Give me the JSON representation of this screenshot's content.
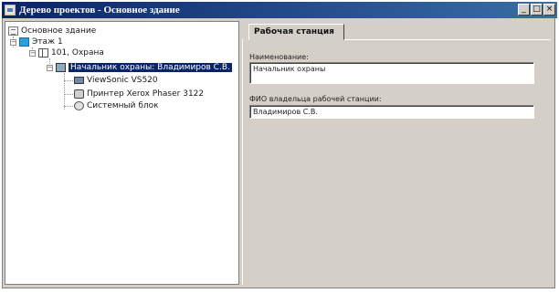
{
  "window": {
    "title": "Дерево проектов - Основное здание",
    "buttons": [
      "_",
      "□",
      "×"
    ]
  },
  "tree": {
    "nodes": [
      {
        "label": "Основное здание",
        "icon": "building-icon"
      },
      {
        "label": "Этаж 1",
        "icon": "floor-icon",
        "expander": "−"
      },
      {
        "label": "101, Охрана",
        "icon": "room-icon",
        "expander": "−"
      },
      {
        "label": "Начальник охраны: Владимиров С.В.",
        "icon": "workstation-icon",
        "expander": "−",
        "selected": true
      },
      {
        "label": "ViewSonic VS520",
        "icon": "monitor-icon"
      },
      {
        "label": "Принтер Xerox Phaser 3122",
        "icon": "printer-icon"
      },
      {
        "label": "Системный блок",
        "icon": "system-unit-icon"
      }
    ]
  },
  "details": {
    "tab_label": "Рабочая станция",
    "name_label": "Наименование:",
    "name_value": "Начальник охраны",
    "owner_label": "ФИО владельца рабочей станции:",
    "owner_value": "Владимиров С.В."
  },
  "colors": {
    "titlebar": "#0a246a",
    "selection": "#0a246a",
    "face": "#d4d0c8"
  }
}
